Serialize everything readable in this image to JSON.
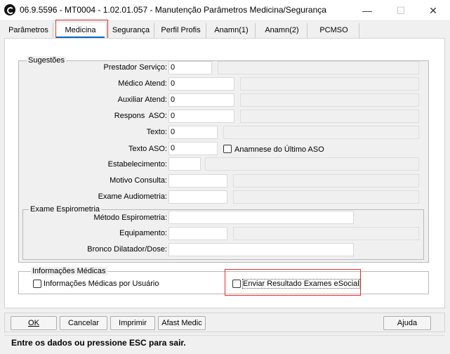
{
  "window": {
    "title": "06.9.5596 - MT0004 - 1.02.01.057 - Manutenção Parâmetros Medicina/Segurança",
    "min_glyph": "—",
    "max_glyph": "☐",
    "close_glyph": "✕"
  },
  "tabs": [
    "Parâmetros",
    "Medicina",
    "Segurança",
    "Perfil Profis",
    "Anamn(1)",
    "Anamn(2)",
    "PCMSO"
  ],
  "sugestoes": {
    "title": "Sugestões",
    "prestador": {
      "label": "Prestador Serviço:",
      "value": "0"
    },
    "medico": {
      "label": "Médico Atend:",
      "value": "0"
    },
    "auxiliar": {
      "label": "Auxiliar Atend:",
      "value": "0"
    },
    "respons": {
      "label": "Respons  ASO:",
      "value": "0"
    },
    "texto": {
      "label": "Texto:",
      "value": "0"
    },
    "texto_aso": {
      "label": "Texto ASO:",
      "value": "0"
    },
    "anamnese_chk": {
      "label": "Anamnese do Último ASO",
      "checked": false
    },
    "estabelecimento": {
      "label": "Estabelecimento:",
      "value": ""
    },
    "motivo": {
      "label": "Motivo Consulta:",
      "value": ""
    },
    "audiometria": {
      "label": "Exame Audiometria:",
      "value": ""
    }
  },
  "espirometria": {
    "title": "Exame Espirometria",
    "metodo": {
      "label": "Método Espirometria:",
      "value": ""
    },
    "equipamento": {
      "label": "Equipamento:",
      "value": ""
    },
    "bronco": {
      "label": "Bronco Dilatador/Dose:",
      "value": ""
    }
  },
  "informacoes": {
    "title": "Informações Médicas",
    "por_usuario": {
      "label": "Informações Médicas por Usuário",
      "checked": false
    },
    "esocial": {
      "label": "Enviar Resultado Exames eSocial",
      "checked": false
    }
  },
  "buttons": {
    "ok": "OK",
    "cancelar": "Cancelar",
    "imprimir": "Imprimir",
    "afast": "Afast Medic",
    "ajuda": "Ajuda"
  },
  "status": "Entre os dados ou pressione ESC para sair.",
  "colors": {
    "active_tab_underline": "#0a64c8",
    "highlight_border": "#e0302a"
  }
}
